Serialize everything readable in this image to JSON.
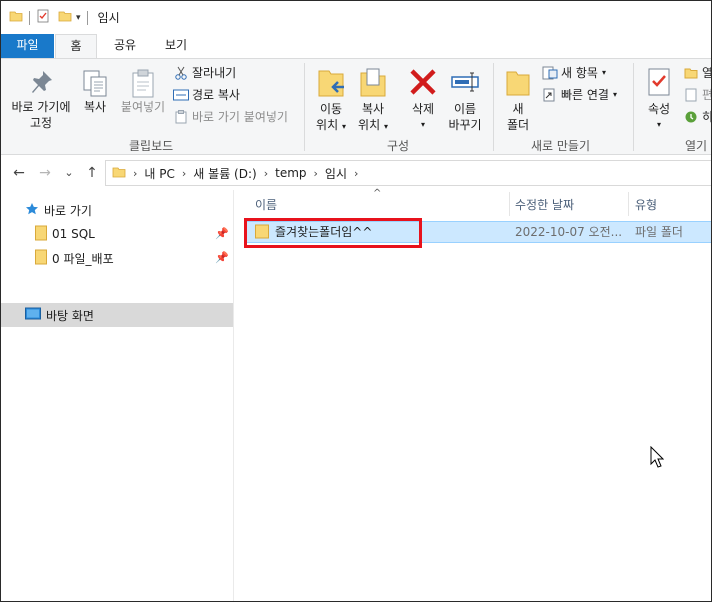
{
  "title_bar": {
    "title": "임시",
    "quick_access_icons": [
      "folder-icon",
      "properties-icon",
      "new-folder-icon",
      "customize-dropdown-icon"
    ]
  },
  "ribbon_tabs": [
    {
      "label": "파일",
      "active": false
    },
    {
      "label": "홈",
      "active": true
    },
    {
      "label": "공유",
      "active": false
    },
    {
      "label": "보기",
      "active": false
    }
  ],
  "ribbon": {
    "clipboard": {
      "pin_label_1": "바로 가기에",
      "pin_label_2": "고정",
      "copy_label": "복사",
      "paste_label": "붙여넣기",
      "cut_label": "잘라내기",
      "copy_path_label": "경로 복사",
      "paste_shortcut_label": "바로 가기 붙여넣기",
      "group_label": "클립보드"
    },
    "organize": {
      "move_to_1": "이동",
      "move_to_2": "위치",
      "copy_to_1": "복사",
      "copy_to_2": "위치",
      "delete_label": "삭제",
      "rename_1": "이름",
      "rename_2": "바꾸기",
      "group_label": "구성"
    },
    "new": {
      "new_folder_1": "새",
      "new_folder_2": "폴더",
      "new_item_label": "새 항목",
      "easy_access_label": "빠른 연결",
      "group_label": "새로 만들기"
    },
    "open": {
      "properties_label": "속성",
      "open_partial": "열",
      "edit_partial": "편",
      "history_partial": "히",
      "group_label": "열기"
    }
  },
  "navigation": {
    "back_icon": "←",
    "forward_icon": "→",
    "recent_icon": "⌄",
    "up_icon": "↑",
    "breadcrumb": [
      "내 PC",
      "새 볼륨 (D:)",
      "temp",
      "임시"
    ]
  },
  "nav_pane": {
    "quick_access_label": "바로 가기",
    "pinned": [
      {
        "label": "01 SQL"
      },
      {
        "label": "0 파일_배포"
      }
    ],
    "desktop_label": "바탕 화면"
  },
  "file_list": {
    "columns": [
      "이름",
      "수정한 날짜",
      "유형"
    ],
    "rows": [
      {
        "name": "즐겨찾는폴더임^^",
        "modified": "2022-10-07 오전...",
        "type": "파일 폴더",
        "selected": true
      }
    ]
  },
  "colors": {
    "file_tab": "#1979ca",
    "selection": "#cce8ff",
    "highlight_box": "#e8121c",
    "folder": "#f8d775"
  }
}
